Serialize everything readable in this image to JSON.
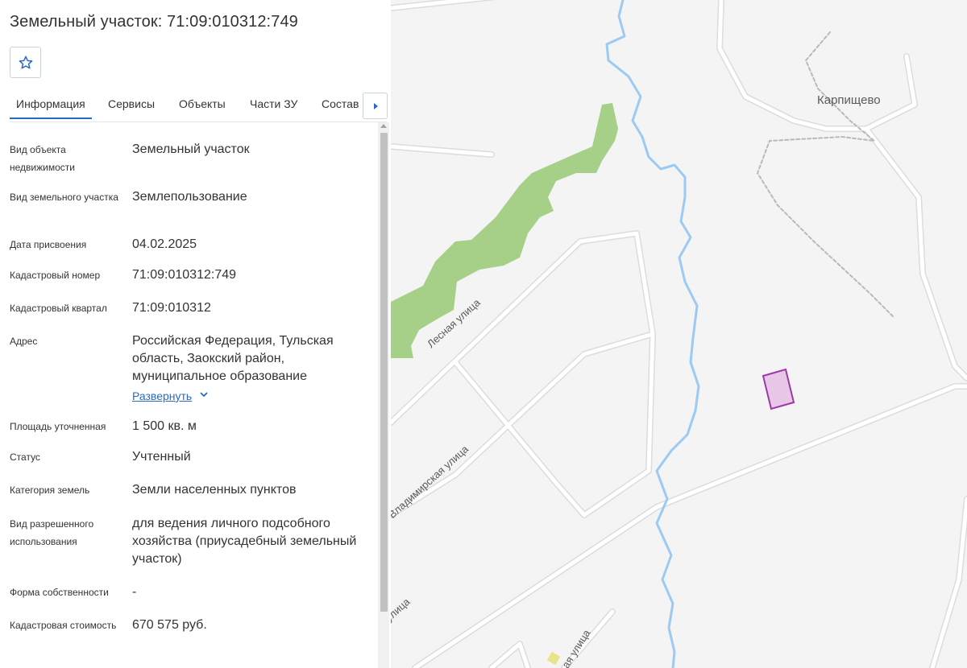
{
  "panel": {
    "title": "Земельный участок: 71:09:010312:749",
    "favorite_icon": "star-outline-icon",
    "tabs": [
      "Информация",
      "Сервисы",
      "Объекты",
      "Части ЗУ",
      "Состав"
    ],
    "active_tab": "Информация",
    "tabs_next_icon": "triangle-right-icon",
    "rows": [
      {
        "label": "Вид объекта недвижимости",
        "value": "Земельный участок"
      },
      {
        "label": "Вид земельного участка",
        "value": "Землепользование"
      },
      {
        "label": "Дата присвоения",
        "value": "04.02.2025"
      },
      {
        "label": "Кадастровый номер",
        "value": "71:09:010312:749"
      },
      {
        "label": "Кадастровый квартал",
        "value": "71:09:010312"
      },
      {
        "label": "Адрес",
        "value": "Российская Федерация, Тульская область, Заокский район, муниципальное образование",
        "expand_label": "Развернуть"
      },
      {
        "label": "Площадь уточненная",
        "value": "1 500 кв. м"
      },
      {
        "label": "Статус",
        "value": "Учтенный"
      },
      {
        "label": "Категория земель",
        "value": "Земли населенных пунктов"
      },
      {
        "label": "Вид разрешенного использования",
        "value": "для ведения личного подсобного хозяйства (приусадебный земельный участок)"
      },
      {
        "label": "Форма собственности",
        "value": "-"
      },
      {
        "label": "Кадастровая стоимость",
        "value": "670 575 руб."
      }
    ]
  },
  "map": {
    "labels": {
      "village": "Карпищево",
      "street_1": "Лесная улица",
      "street_2": "Владимирская улица",
      "street_3": "улица",
      "street_4": "ая улица"
    },
    "colors": {
      "background": "#f4f4f5",
      "forest": "#a6cf88",
      "river": "#9ccaf2",
      "road": "#ffffff",
      "parcel_fill": "#e8c6e8",
      "parcel_stroke": "#9b3aa6"
    }
  }
}
